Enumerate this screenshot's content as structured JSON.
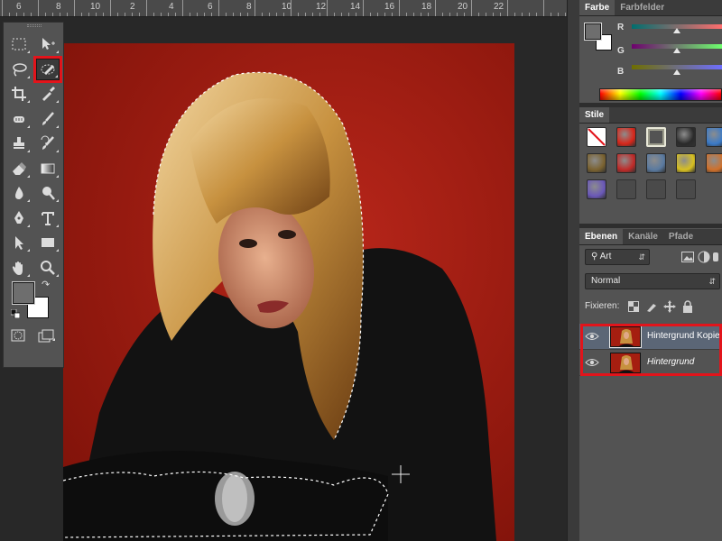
{
  "ruler": {
    "labels": [
      "6",
      "8",
      "10",
      "2",
      "4",
      "6",
      "8",
      "10",
      "12",
      "14",
      "16",
      "18",
      "20",
      "22"
    ]
  },
  "toolbar": {
    "tools": [
      {
        "name": "rectangular-marquee-tool-icon",
        "selected": false
      },
      {
        "name": "move-tool-icon",
        "selected": false
      },
      {
        "name": "lasso-tool-icon",
        "selected": false
      },
      {
        "name": "quick-selection-tool-icon",
        "selected": true
      },
      {
        "name": "crop-tool-icon",
        "selected": false
      },
      {
        "name": "eyedropper-tool-icon",
        "selected": false
      },
      {
        "name": "healing-brush-tool-icon",
        "selected": false
      },
      {
        "name": "brush-tool-icon",
        "selected": false
      },
      {
        "name": "clone-stamp-tool-icon",
        "selected": false
      },
      {
        "name": "history-brush-tool-icon",
        "selected": false
      },
      {
        "name": "eraser-tool-icon",
        "selected": false
      },
      {
        "name": "gradient-tool-icon",
        "selected": false
      },
      {
        "name": "blur-tool-icon",
        "selected": false
      },
      {
        "name": "dodge-tool-icon",
        "selected": false
      },
      {
        "name": "pen-tool-icon",
        "selected": false
      },
      {
        "name": "type-tool-icon",
        "selected": false
      },
      {
        "name": "path-selection-tool-icon",
        "selected": false
      },
      {
        "name": "rectangle-tool-icon",
        "selected": false
      },
      {
        "name": "hand-tool-icon",
        "selected": false
      },
      {
        "name": "zoom-tool-icon",
        "selected": false
      }
    ],
    "foreground_color": "#6e6e6e",
    "background_color": "#ffffff"
  },
  "color_panel": {
    "tabs": [
      "Farbe",
      "Farbfelder"
    ],
    "active_tab": "Farbe",
    "channels": [
      {
        "label": "R",
        "value_fraction": 0.5
      },
      {
        "label": "G",
        "value_fraction": 0.5
      },
      {
        "label": "B",
        "value_fraction": 0.5
      }
    ],
    "foreground": "#6e6e6e",
    "background": "#ffffff"
  },
  "styles_panel": {
    "tab": "Stile",
    "cells": [
      {
        "name": "style-none-icon",
        "color": "#ffffff"
      },
      {
        "name": "style-red-glow-icon",
        "color": "#d8261a"
      },
      {
        "name": "style-frame-icon",
        "color": "#9a9a8a"
      },
      {
        "name": "style-chrome-icon",
        "color": "#2a2a2a"
      },
      {
        "name": "style-blue-glass-icon",
        "color": "#3a7ac8"
      },
      {
        "name": "style-bronze-icon",
        "color": "#7a6230"
      },
      {
        "name": "style-red-bevel-icon",
        "color": "#c02a28"
      },
      {
        "name": "style-multicolor-icon",
        "color": "#5a7aa0"
      },
      {
        "name": "style-gold-icon",
        "color": "#d8c020"
      },
      {
        "name": "style-sunset-icon",
        "color": "#d0702a"
      },
      {
        "name": "style-purple-icon",
        "color": "#6a58b8"
      },
      {
        "name": "style-empty-icon",
        "color": "#4a4a4a"
      },
      {
        "name": "style-empty-icon",
        "color": "#4a4a4a"
      },
      {
        "name": "style-empty-icon",
        "color": "#4a4a4a"
      }
    ]
  },
  "layers_panel": {
    "tabs": [
      "Ebenen",
      "Kanäle",
      "Pfade"
    ],
    "active_tab": "Ebenen",
    "filter_label": "Art",
    "blend_mode": "Normal",
    "lock_label": "Fixieren:",
    "layers": [
      {
        "name": "Hintergrund Kopie",
        "italic": false,
        "active": true
      },
      {
        "name": "Hintergrund",
        "italic": true,
        "active": false
      }
    ]
  },
  "accent_color": "#e2141b"
}
